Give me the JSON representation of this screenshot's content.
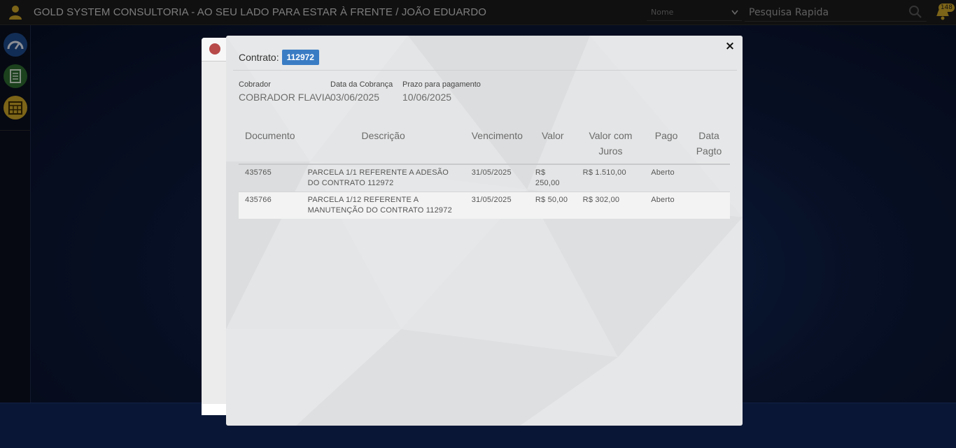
{
  "topbar": {
    "title": "GOLD SYSTEM CONSULTORIA - AO SEU LADO PARA ESTAR À FRENTE / JOÃO EDUARDO",
    "select_value": "Nome",
    "search_placeholder": "Pesquisa Rapida",
    "notification_count": "148",
    "icons": [
      "user-icon",
      "chevron-down-icon",
      "search-icon",
      "bell-icon"
    ]
  },
  "sidebar": {
    "items": [
      {
        "name": "dashboard",
        "icon": "speedometer-icon",
        "color": "#1d4a8a"
      },
      {
        "name": "documents",
        "icon": "document-icon",
        "color": "#2c6a2f"
      },
      {
        "name": "calendar",
        "icon": "calendar-icon",
        "color": "#c9a227"
      }
    ]
  },
  "modal": {
    "contract_label": "Contrato:",
    "contract_number": "112972",
    "close_icon": "×",
    "info": {
      "cobrador_label": "Cobrador",
      "cobrador_value": "COBRADOR FLAVIA",
      "data_cobranca_label": "Data da Cobrança",
      "data_cobranca_value": "03/06/2025",
      "prazo_label": "Prazo para pagamento",
      "prazo_value": "10/06/2025"
    },
    "table": {
      "headers": [
        "Documento",
        "Descrição",
        "Vencimento",
        "Valor",
        "Valor com Juros",
        "Pago",
        "Data Pagto"
      ],
      "rows": [
        {
          "documento": "435765",
          "descricao": "PARCELA 1/1 REFERENTE A ADESÃO DO CONTRATO 112972",
          "vencimento": "31/05/2025",
          "valor": "R$ 250,00",
          "valor_juros": "R$ 1.510,00",
          "pago": "Aberto",
          "data_pagto": ""
        },
        {
          "documento": "435766",
          "descricao": "PARCELA 1/12 REFERENTE A MANUTENÇÃO DO CONTRATO 112972",
          "vencimento": "31/05/2025",
          "valor": "R$ 50,00",
          "valor_juros": "R$ 302,00",
          "pago": "Aberto",
          "data_pagto": ""
        }
      ]
    }
  },
  "colors": {
    "accent_badge": "#3a7cc4",
    "status_open": "#d40000",
    "brand_gold": "#c9a227"
  }
}
